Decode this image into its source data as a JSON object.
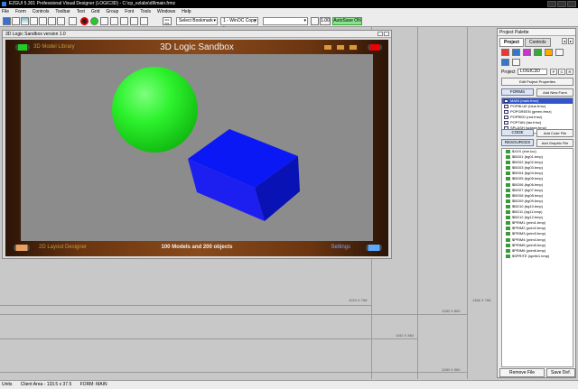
{
  "window": {
    "title": "EZGUI 5.301 Professional Visual Designer  (LOGIC3D) - C:\\cp_ezlabs\\dll\\main.frmz"
  },
  "menu": [
    "File",
    "Form",
    "Controls",
    "Toolbar",
    "Text",
    "Grid",
    "Group",
    "Font",
    "Tools",
    "Windows",
    "Help"
  ],
  "toolbar": {
    "counter_top": "001",
    "counter_bottom": "001",
    "bookmark_label": "Select Bookmark",
    "window_style": "1 - WinOC Copy -",
    "empty_select": "",
    "zoom_value": "1.00",
    "autosave_label": "AutoSave ON"
  },
  "icons": {
    "save": "save-icon",
    "open": "open-folder-icon",
    "record": "record-icon",
    "play": "play-icon"
  },
  "workspace": {
    "resolution_labels": [
      "1024 X 768",
      "1280 X 800",
      "1366 X 768",
      "1152 X 864",
      "1280 X 960"
    ]
  },
  "form_window": {
    "title": "3D Logic Sandbox version 1.0",
    "top_left_label": "3D Model Library",
    "main_title": "3D Logic Sandbox",
    "bottom_left_label": "2D Layout Designer",
    "bottom_center_label": "100 Models and 200 objects",
    "bottom_right_label": "Settings"
  },
  "palette": {
    "title": "Project Palette",
    "tab_project": "Project",
    "tab_controls": "Controls",
    "project_label": "Project",
    "project_name": "LOGIC3D",
    "btn_p": "P",
    "btn_c": "C",
    "btn_r": "R",
    "edit_props": "Edit Project Properties",
    "forms_header": "FORMS",
    "add_new_form": "Add New Form",
    "forms": [
      {
        "name": "MAIN",
        "file": "(main.frmz)",
        "selected": true
      },
      {
        "name": "POPBLUE",
        "file": "(blue.frmz)",
        "selected": false
      },
      {
        "name": "POPGREEN",
        "file": "(green.frmz)",
        "selected": false
      },
      {
        "name": "POPRED",
        "file": "(red.frmz)",
        "selected": false
      },
      {
        "name": "POPTAN",
        "file": "(tan.frmz)",
        "selected": false
      },
      {
        "name": "SPLASH",
        "file": "(splash.frmz)",
        "selected": false
      }
    ],
    "code_header": "CODE",
    "add_code_file": "Add Code File",
    "resources_header": "RESOURCES",
    "add_graphic_file": "Add Graphic File",
    "resources": [
      "$XXX  (exe.ico)",
      "$BG01  (bg01.bmp)",
      "$BG02  (bg02.bmp)",
      "$BG03  (bg03.bmp)",
      "$BG04  (bg04.bmp)",
      "$BG05  (bg05.bmp)",
      "$BG06  (bg06.bmp)",
      "$BG07  (bg07.bmp)",
      "$BG08  (bg08.bmp)",
      "$BG09  (bg09.bmp)",
      "$BG10  (bg10.bmp)",
      "$BG11  (bg11.bmp)",
      "$BG12  (bg12.bmp)",
      "$PRIM1  (prim1.bmp)",
      "$PRIM2  (prim2.bmp)",
      "$PRIM3  (prim3.bmp)",
      "$PRIM4  (prim4.bmp)",
      "$PRIM5  (prim5.bmp)",
      "$PRIM6  (prim6.bmp)",
      "$SPRITE  (sprite1.bmp)"
    ],
    "remove_file": "Remove File",
    "save_def": "Save Def."
  },
  "status": {
    "units": "Units",
    "client_area": "Client Area - 133.5 x 37.5",
    "form": "FORM: MAIN"
  }
}
